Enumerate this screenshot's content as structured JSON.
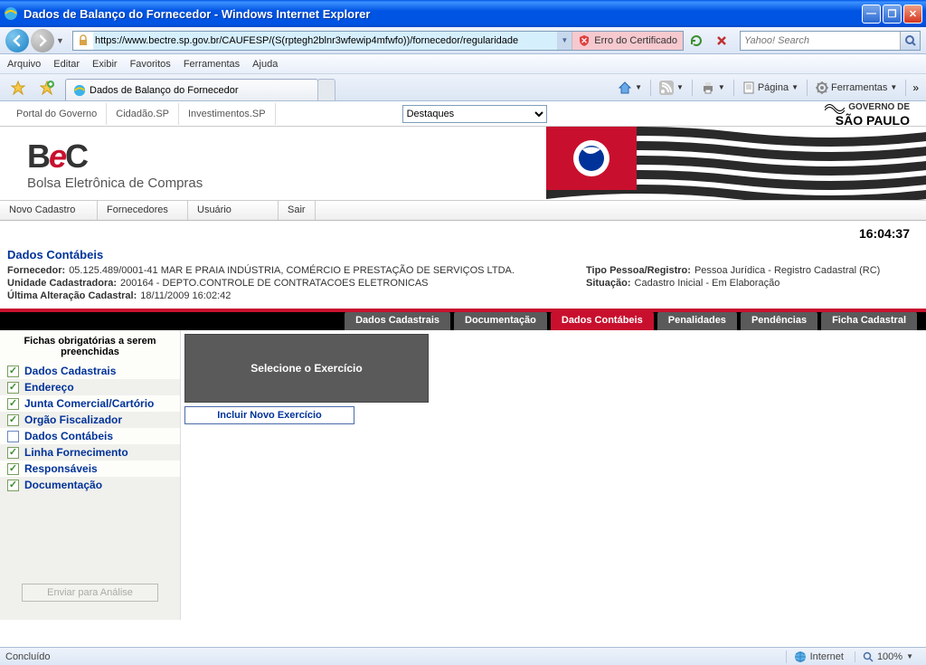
{
  "window": {
    "title": "Dados de Balanço do Fornecedor - Windows Internet Explorer",
    "url": "https://www.bectre.sp.gov.br/CAUFESP/(S(rptegh2blnr3wfewip4mfwfo))/fornecedor/regularidade",
    "cert_error": "Erro do Certificado",
    "search_placeholder": "Yahoo! Search"
  },
  "menu": {
    "arquivo": "Arquivo",
    "editar": "Editar",
    "exibir": "Exibir",
    "favoritos": "Favoritos",
    "ferramentas": "Ferramentas",
    "ajuda": "Ajuda"
  },
  "tab": {
    "title": "Dados de Balanço do Fornecedor"
  },
  "cmd": {
    "pagina": "Página",
    "ferramentas": "Ferramentas"
  },
  "portal": {
    "link1": "Portal do Governo",
    "link2": "Cidadão.SP",
    "link3": "Investimentos.SP",
    "destaques": "Destaques",
    "gov1": "GOVERNO DE",
    "gov2": "SÃO PAULO"
  },
  "bec": {
    "sub": "Bolsa Eletrônica de Compras"
  },
  "mainmenu": {
    "novo": "Novo Cadastro",
    "forn": "Fornecedores",
    "usuario": "Usuário",
    "sair": "Sair"
  },
  "clock": "16:04:37",
  "section": {
    "title": "Dados Contábeis",
    "fornecedor_lbl": "Fornecedor:",
    "fornecedor_val": "05.125.489/0001-41  MAR E PRAIA INDÚSTRIA, COMÉRCIO E PRESTAÇÃO DE SERVIÇOS LTDA.",
    "tipo_lbl": "Tipo Pessoa/Registro:",
    "tipo_val": "Pessoa Jurídica - Registro Cadastral (RC)",
    "unidade_lbl": "Unidade Cadastradora:",
    "unidade_val": "200164 - DEPTO.CONTROLE DE CONTRATACOES ELETRONICAS",
    "situacao_lbl": "Situação:",
    "situacao_val": "Cadastro Inicial - Em Elaboração",
    "ultima_lbl": "Última Alteração Cadastral:",
    "ultima_val": "18/11/2009 16:02:42"
  },
  "tabs": {
    "t1": "Dados Cadastrais",
    "t2": "Documentação",
    "t3": "Dados Contábeis",
    "t4": "Penalidades",
    "t5": "Pendências",
    "t6": "Ficha Cadastral"
  },
  "sidebar": {
    "head": "Fichas obrigatórias a serem preenchidas",
    "items": [
      {
        "label": "Dados Cadastrais",
        "checked": true
      },
      {
        "label": "Endereço",
        "checked": true
      },
      {
        "label": "Junta Comercial/Cartório",
        "checked": true
      },
      {
        "label": "Orgão Fiscalizador",
        "checked": true
      },
      {
        "label": "Dados Contábeis",
        "checked": false
      },
      {
        "label": "Linha Fornecimento",
        "checked": true
      },
      {
        "label": "Responsáveis",
        "checked": true
      },
      {
        "label": "Documentação",
        "checked": true
      }
    ],
    "send": "Enviar para Análise"
  },
  "content": {
    "box": "Selecione o Exercício",
    "incluir": "Incluir Novo Exercício"
  },
  "status": {
    "left": "Concluído",
    "zone": "Internet",
    "zoom": "100%"
  }
}
